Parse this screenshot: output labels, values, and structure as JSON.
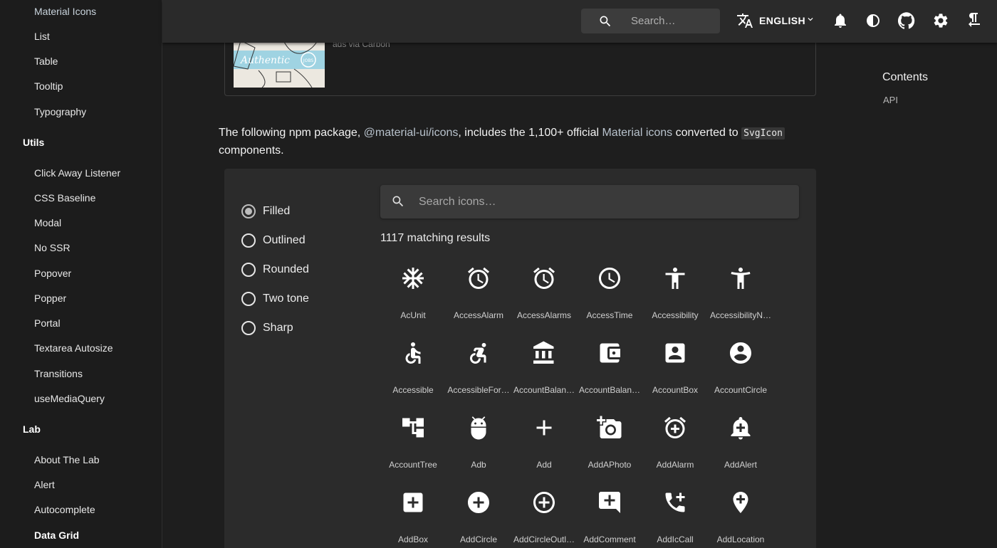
{
  "sidebar": {
    "items_top": [
      "Material Icons",
      "List",
      "Table",
      "Tooltip",
      "Typography"
    ],
    "section_utils": "Utils",
    "items_utils": [
      "Click Away Listener",
      "CSS Baseline",
      "Modal",
      "No SSR",
      "Popover",
      "Popper",
      "Portal",
      "Textarea Autosize",
      "Transitions",
      "useMediaQuery"
    ],
    "section_lab": "Lab",
    "items_lab": [
      "About The Lab",
      "Alert",
      "Autocomplete",
      "Data Grid"
    ]
  },
  "topbar": {
    "search_placeholder": "Search…",
    "language": "ENGLISH",
    "icons": [
      "translate-icon",
      "chevron-down-icon",
      "notifications-icon",
      "contrast-icon",
      "github-icon",
      "settings-icon",
      "rtl-icon"
    ]
  },
  "carbon": {
    "caption": "ads via Carbon",
    "image_text": "Authentic",
    "image_badge": "JOBS"
  },
  "intro": {
    "t1": "The following npm package, ",
    "pkg": "@material-ui/icons",
    "t2": ", includes the 1,100+ official ",
    "link": "Material icons",
    "t3": " converted to ",
    "code": "SvgIcon",
    "t4": " components."
  },
  "icon_search": {
    "placeholder": "Search icons…",
    "results": "1117 matching results"
  },
  "themes": {
    "options": [
      "Filled",
      "Outlined",
      "Rounded",
      "Two tone",
      "Sharp"
    ],
    "selected": "Filled"
  },
  "icons": [
    {
      "name": "AcUnit",
      "icon": "ac-unit-icon"
    },
    {
      "name": "AccessAlarm",
      "icon": "access-alarm-icon"
    },
    {
      "name": "AccessAlarms",
      "icon": "access-alarms-icon"
    },
    {
      "name": "AccessTime",
      "icon": "access-time-icon"
    },
    {
      "name": "Accessibility",
      "icon": "accessibility-icon"
    },
    {
      "name": "AccessibilityN…",
      "icon": "accessibility-new-icon"
    },
    {
      "name": "Accessible",
      "icon": "accessible-icon"
    },
    {
      "name": "AccessibleFor…",
      "icon": "accessible-forward-icon"
    },
    {
      "name": "AccountBalan…",
      "icon": "account-balance-icon"
    },
    {
      "name": "AccountBalan…",
      "icon": "account-balance-wallet-icon"
    },
    {
      "name": "AccountBox",
      "icon": "account-box-icon"
    },
    {
      "name": "AccountCircle",
      "icon": "account-circle-icon"
    },
    {
      "name": "AccountTree",
      "icon": "account-tree-icon"
    },
    {
      "name": "Adb",
      "icon": "adb-icon"
    },
    {
      "name": "Add",
      "icon": "add-icon"
    },
    {
      "name": "AddAPhoto",
      "icon": "add-a-photo-icon"
    },
    {
      "name": "AddAlarm",
      "icon": "add-alarm-icon"
    },
    {
      "name": "AddAlert",
      "icon": "add-alert-icon"
    },
    {
      "name": "AddBox",
      "icon": "add-box-icon"
    },
    {
      "name": "AddCircle",
      "icon": "add-circle-icon"
    },
    {
      "name": "AddCircleOutl…",
      "icon": "add-circle-outline-icon"
    },
    {
      "name": "AddComment",
      "icon": "add-comment-icon"
    },
    {
      "name": "AddIcCall",
      "icon": "add-ic-call-icon"
    },
    {
      "name": "AddLocation",
      "icon": "add-location-icon"
    }
  ],
  "toc": {
    "title": "Contents",
    "links": [
      "API"
    ]
  }
}
